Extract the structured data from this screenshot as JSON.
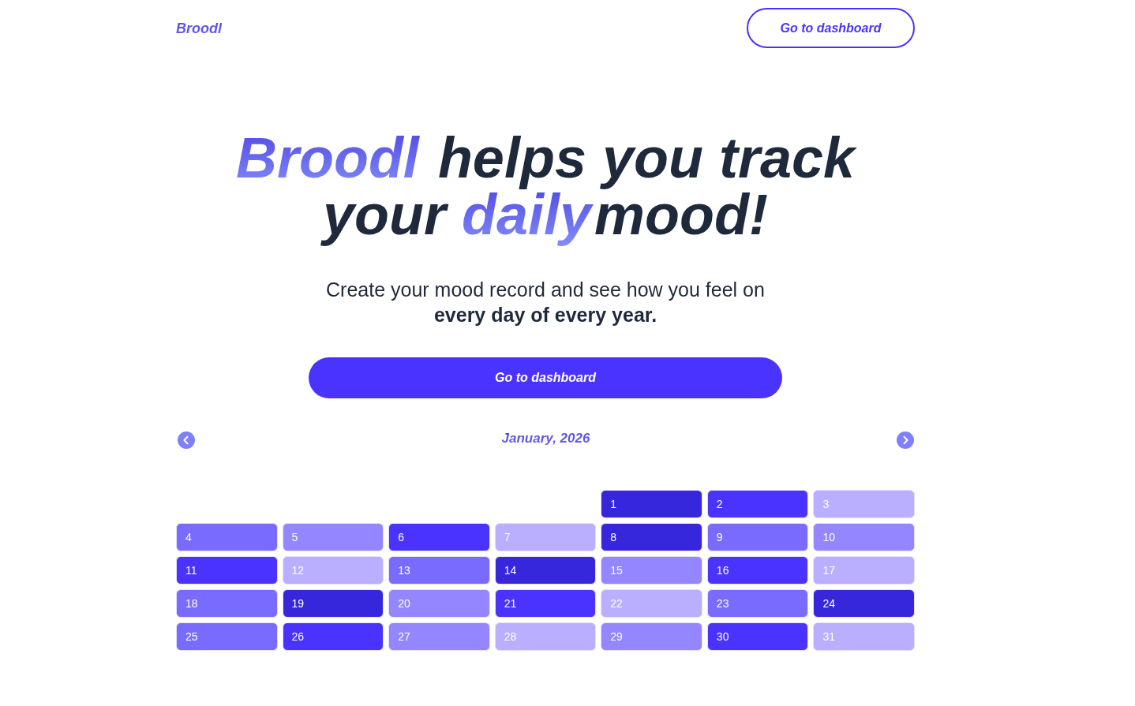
{
  "header": {
    "logo": "Broodl",
    "button": "Go to dashboard"
  },
  "hero": {
    "headline": [
      {
        "text": "Broodl",
        "highlight": true
      },
      {
        "text": " helps you track your ",
        "highlight": false
      },
      {
        "text": "daily",
        "highlight": true
      },
      {
        "text": "mood!",
        "highlight": false
      }
    ],
    "subtitle": "Create your mood record and see how you feel on **every day of every year.**",
    "button": "Go to dashboard"
  },
  "calendar": {
    "title": "January, 2026",
    "weeks": [
      [
        {
          "day": "1",
          "color": "#3727dc"
        },
        {
          "day": "2",
          "color": "#4a33ff"
        },
        {
          "day": "3",
          "color": "#b9aeff"
        }
      ],
      [
        {
          "day": "4",
          "color": "#7a6bff"
        },
        {
          "day": "5",
          "color": "#9486ff"
        },
        {
          "day": "6",
          "color": "#4a33ff"
        },
        {
          "day": "7",
          "color": "#b9aeff"
        },
        {
          "day": "8",
          "color": "#3727dc"
        },
        {
          "day": "9",
          "color": "#7a6bff"
        },
        {
          "day": "10",
          "color": "#9486ff"
        }
      ],
      [
        {
          "day": "11",
          "color": "#4a33ff"
        },
        {
          "day": "12",
          "color": "#b9aeff"
        },
        {
          "day": "13",
          "color": "#7a6bff"
        },
        {
          "day": "14",
          "color": "#3727dc"
        },
        {
          "day": "15",
          "color": "#9486ff"
        },
        {
          "day": "16",
          "color": "#4a33ff"
        },
        {
          "day": "17",
          "color": "#b9aeff"
        }
      ],
      [
        {
          "day": "18",
          "color": "#7a6bff"
        },
        {
          "day": "19",
          "color": "#3727dc"
        },
        {
          "day": "20",
          "color": "#9486ff"
        },
        {
          "day": "21",
          "color": "#4a33ff"
        },
        {
          "day": "22",
          "color": "#b9aeff"
        },
        {
          "day": "23",
          "color": "#7a6bff"
        },
        {
          "day": "24",
          "color": "#3727dc"
        }
      ],
      [
        {
          "day": "25",
          "color": "#7a6bff"
        },
        {
          "day": "26",
          "color": "#4a33ff"
        },
        {
          "day": "27",
          "color": "#9486ff"
        },
        {
          "day": "28",
          "color": "#b9aeff"
        },
        {
          "day": "29",
          "color": "#9486ff"
        },
        {
          "day": "30",
          "color": "#4a33ff"
        },
        {
          "day": "31",
          "color": "#b9aeff"
        }
      ]
    ]
  }
}
